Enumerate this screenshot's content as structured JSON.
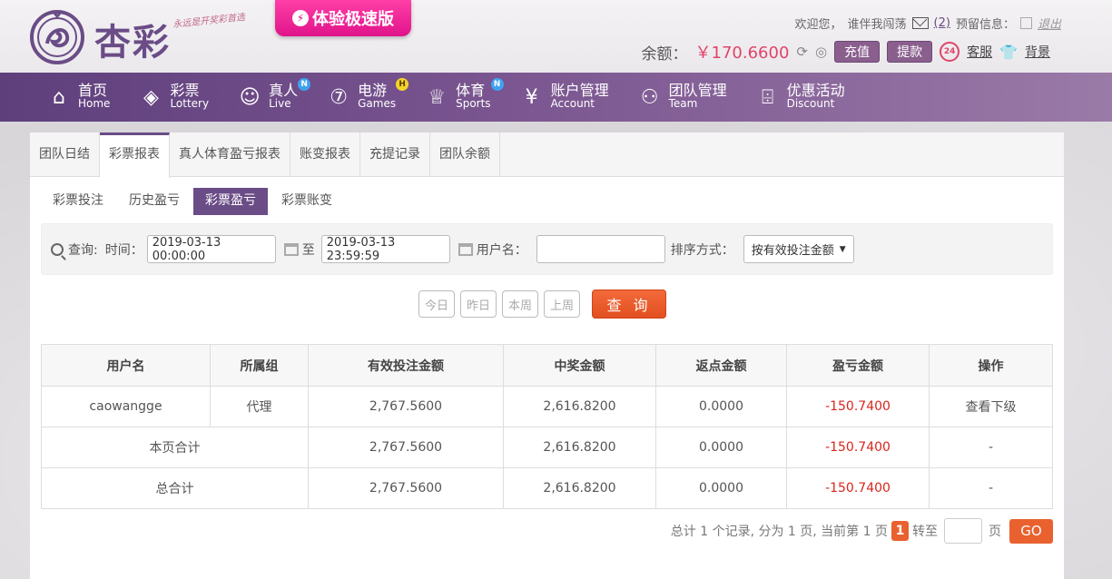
{
  "header": {
    "logo_text": "杏彩",
    "slogan": "永远是开奖彩首选",
    "promo_label": "体验极速版",
    "welcome": "欢迎您，",
    "username": "谁伴我闯荡",
    "mail_count": "(2)",
    "reserved_info": "预留信息：",
    "logout": "退出",
    "balance_label": "余额：",
    "balance_value": "￥170.6600",
    "recharge": "充值",
    "withdraw": "提款",
    "customer_service": "客服",
    "cs_badge": "24",
    "background": "背景"
  },
  "nav": {
    "items": [
      {
        "cn": "首页",
        "en": "Home"
      },
      {
        "cn": "彩票",
        "en": "Lottery"
      },
      {
        "cn": "真人",
        "en": "Live",
        "badge": "N"
      },
      {
        "cn": "电游",
        "en": "Games",
        "badge": "H"
      },
      {
        "cn": "体育",
        "en": "Sports",
        "badge": "N"
      },
      {
        "cn": "账户管理",
        "en": "Account"
      },
      {
        "cn": "团队管理",
        "en": "Team"
      },
      {
        "cn": "优惠活动",
        "en": "Discount"
      }
    ]
  },
  "tabs": [
    "团队日结",
    "彩票报表",
    "真人体育盈亏报表",
    "账变报表",
    "充提记录",
    "团队余额"
  ],
  "active_tab": "彩票报表",
  "subtabs": [
    "彩票投注",
    "历史盈亏",
    "彩票盈亏",
    "彩票账变"
  ],
  "active_subtab": "彩票盈亏",
  "query": {
    "label": "查询:",
    "time_label": "时间：",
    "start_time": "2019-03-13 00:00:00",
    "to": "至",
    "end_time": "2019-03-13 23:59:59",
    "username_label": "用户名：",
    "username_value": "",
    "sort_label": "排序方式：",
    "sort_value": "按有效投注金额",
    "quick": [
      "今日",
      "昨日",
      "本周",
      "上周"
    ],
    "search_button": "查 询"
  },
  "table": {
    "headers": [
      "用户名",
      "所属组",
      "有效投注金额",
      "中奖金额",
      "返点金额",
      "盈亏金额",
      "操作"
    ],
    "row": {
      "username": "caowangge",
      "group": "代理",
      "bet": "2,767.5600",
      "win": "2,616.8200",
      "rebate": "0.0000",
      "profit": "-150.7400",
      "action": "查看下级"
    },
    "page_total": {
      "label": "本页合计",
      "bet": "2,767.5600",
      "win": "2,616.8200",
      "rebate": "0.0000",
      "profit": "-150.7400",
      "action": "-"
    },
    "grand_total": {
      "label": "总合计",
      "bet": "2,767.5600",
      "win": "2,616.8200",
      "rebate": "0.0000",
      "profit": "-150.7400",
      "action": "-"
    }
  },
  "pager": {
    "summary": "总计 1 个记录, 分为 1 页, 当前第 1 页",
    "current": "1",
    "goto": "转至",
    "page_unit": "页",
    "go": "GO"
  },
  "colors": {
    "brand_purple": "#6a4c86",
    "accent_orange": "#e9612e",
    "loss_red": "#d9251c",
    "promo_pink": "#e0138a"
  }
}
